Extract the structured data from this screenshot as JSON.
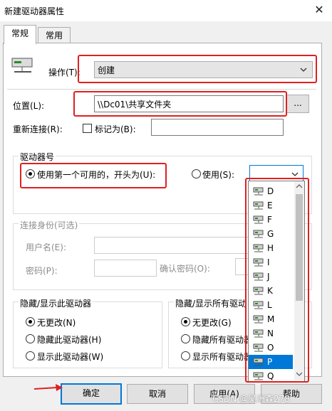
{
  "window": {
    "title": "新建驱动器属性",
    "close_glyph": "✕"
  },
  "tabs": [
    {
      "label": "常规"
    },
    {
      "label": "常用"
    }
  ],
  "general": {
    "operation_label": "操作(T):",
    "operation_value": "创建",
    "location_label": "位置(L):",
    "location_value": "\\\\Dc01\\共享文件夹",
    "browse_label": "...",
    "reconnect_label": "重新连接(R):",
    "label_as": "标记为(B):",
    "drive_letter_group": "驱动器号",
    "use_first_available": "使用第一个可用的，开头为(U):",
    "use_label": "使用(S):",
    "connect_as_group": "连接身份(可选)",
    "username_label": "用户名(E):",
    "password_label": "密码(P):",
    "confirm_password_label": "确认密码(O):"
  },
  "hide_this": {
    "title": "隐藏/显示此驱动器",
    "options": [
      "无更改(N)",
      "隐藏此驱动器(H)",
      "显示此驱动器(W)"
    ]
  },
  "hide_all": {
    "title": "隐藏/显示所有驱动",
    "options": [
      "无更改(G)",
      "隐藏所有驱动器",
      "显示所有驱动器"
    ]
  },
  "drive_list": [
    "D",
    "E",
    "F",
    "G",
    "H",
    "I",
    "J",
    "K",
    "L",
    "M",
    "N",
    "O",
    "P",
    "Q"
  ],
  "drive_list_selected": "P",
  "buttons": {
    "ok": "确定",
    "cancel": "取消",
    "apply": "应用(A)",
    "help": "帮助"
  },
  "watermark": "CSDN @吴洲森278",
  "colors": {
    "highlight": "#e02020",
    "selection": "#0078d7",
    "arrow": "#e02020"
  },
  "icons": {
    "drive": "network-drive-icon",
    "dropdown": "chevron-down-icon",
    "pointer": "red-arrow-icon"
  }
}
